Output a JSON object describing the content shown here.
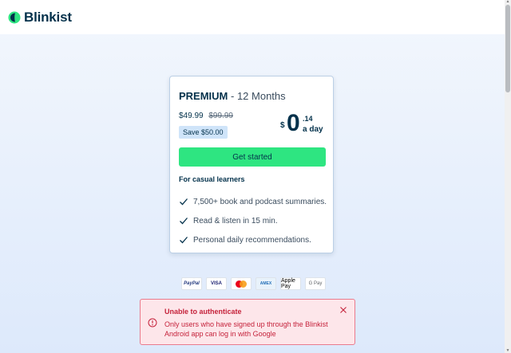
{
  "header": {
    "brand": "Blinkist"
  },
  "offer": {
    "plan_name": "PREMIUM",
    "plan_term": " - 12 Months",
    "price": "$49.99",
    "old_price": "$99.99",
    "save_badge": "Save $50.00",
    "daily_currency": "$",
    "daily_whole": "0",
    "daily_cents": ".14",
    "daily_unit": "a day",
    "cta_label": "Get started",
    "audience": "For casual learners",
    "features": [
      "7,500+ book and podcast summaries.",
      "Read & listen in 15 min.",
      "Personal daily recommendations."
    ]
  },
  "payments": [
    "PayPal",
    "VISA",
    "Mastercard",
    "AMEX",
    "Apple Pay",
    "G Pay"
  ],
  "toast": {
    "title": "Unable to authenticate",
    "message": "Only users who have signed up through the Blinkist Android app can log in with Google"
  },
  "colors": {
    "accent_green": "#2ee581",
    "brand_navy": "#03314b",
    "error_red": "#c5223b",
    "badge_blue": "#cfe4f9"
  }
}
